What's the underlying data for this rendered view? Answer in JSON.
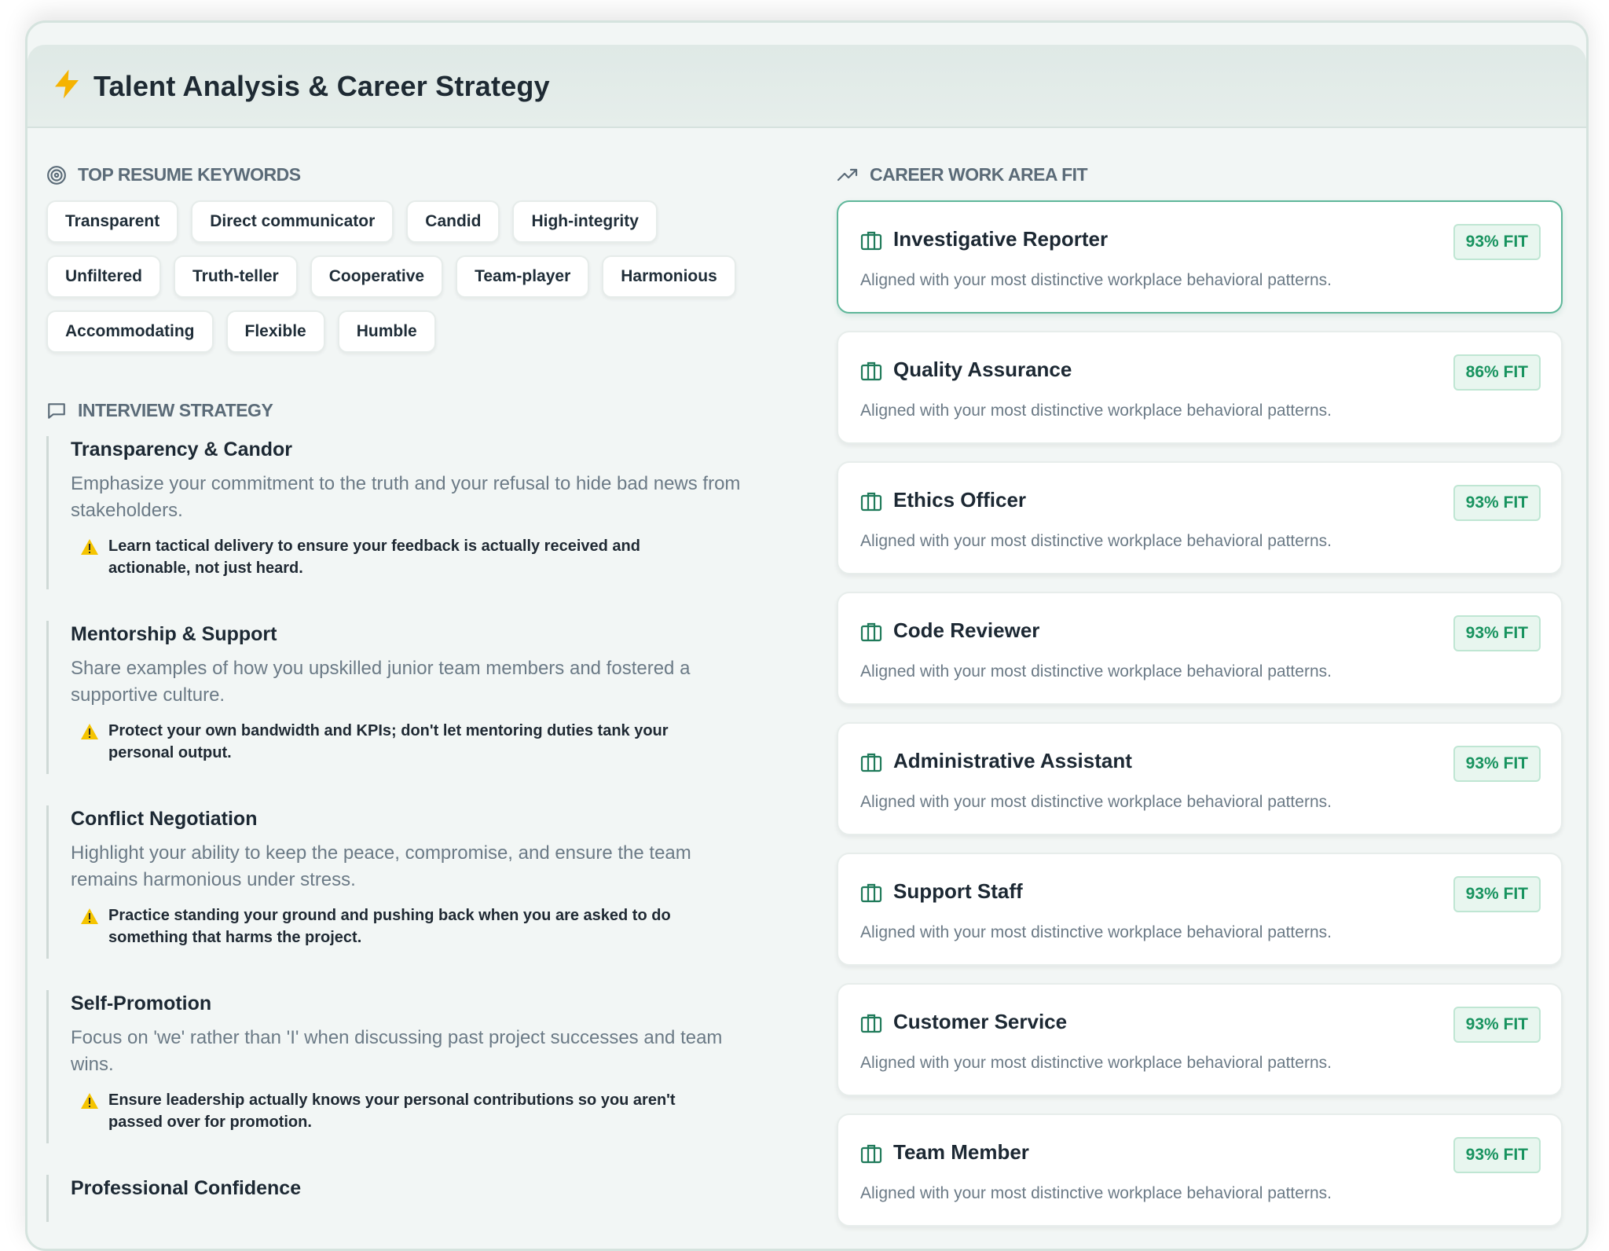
{
  "header": {
    "title": "Talent Analysis & Career Strategy"
  },
  "keywords": {
    "label": "TOP RESUME KEYWORDS",
    "rows": [
      [
        "Transparent",
        "Direct communicator",
        "Candid",
        "High-integrity"
      ],
      [
        "Unfiltered",
        "Truth-teller",
        "Cooperative",
        "Team-player",
        "Harmonious"
      ],
      [
        "Accommodating",
        "Flexible",
        "Humble"
      ]
    ]
  },
  "strategy": {
    "label": "INTERVIEW STRATEGY",
    "items": [
      {
        "title": "Transparency & Candor",
        "desc": "Emphasize your commitment to the truth and your refusal to hide bad news from stakeholders.",
        "tip": "Learn tactical delivery to ensure your feedback is actually received and actionable, not just heard."
      },
      {
        "title": "Mentorship & Support",
        "desc": "Share examples of how you upskilled junior team members and fostered a supportive culture.",
        "tip": "Protect your own bandwidth and KPIs; don't let mentoring duties tank your personal output."
      },
      {
        "title": "Conflict Negotiation",
        "desc": "Highlight your ability to keep the peace, compromise, and ensure the team remains harmonious under stress.",
        "tip": "Practice standing your ground and pushing back when you are asked to do something that harms the project."
      },
      {
        "title": "Self-Promotion",
        "desc": "Focus on 'we' rather than 'I' when discussing past project successes and team wins.",
        "tip": "Ensure leadership actually knows your personal contributions so you aren't passed over for promotion."
      },
      {
        "title": "Professional Confidence"
      }
    ]
  },
  "fit": {
    "label": "CAREER WORK AREA FIT",
    "cards": [
      {
        "title": "Investigative Reporter",
        "badge": "93% FIT",
        "desc": "Aligned with your most distinctive workplace behavioral patterns."
      },
      {
        "title": "Quality Assurance",
        "badge": "86% FIT",
        "desc": "Aligned with your most distinctive workplace behavioral patterns."
      },
      {
        "title": "Ethics Officer",
        "badge": "93% FIT",
        "desc": "Aligned with your most distinctive workplace behavioral patterns."
      },
      {
        "title": "Code Reviewer",
        "badge": "93% FIT",
        "desc": "Aligned with your most distinctive workplace behavioral patterns."
      },
      {
        "title": "Administrative Assistant",
        "badge": "93% FIT",
        "desc": "Aligned with your most distinctive workplace behavioral patterns."
      },
      {
        "title": "Support Staff",
        "badge": "93% FIT",
        "desc": "Aligned with your most distinctive workplace behavioral patterns."
      },
      {
        "title": "Customer Service",
        "badge": "93% FIT",
        "desc": "Aligned with your most distinctive workplace behavioral patterns."
      },
      {
        "title": "Team Member",
        "badge": "93% FIT",
        "desc": "Aligned with your most distinctive workplace behavioral patterns."
      }
    ]
  },
  "colors": {
    "accent_green": "#18935f",
    "badge_bg": "#e8f6ef",
    "bolt": "#f5b301",
    "warning": "#f5c400"
  },
  "icons": {
    "header": "lightning-bolt-icon",
    "keywords": "target-icon",
    "strategy": "message-square-icon",
    "fit": "trending-up-icon",
    "card": "briefcase-icon",
    "tip": "warning-triangle-icon"
  }
}
